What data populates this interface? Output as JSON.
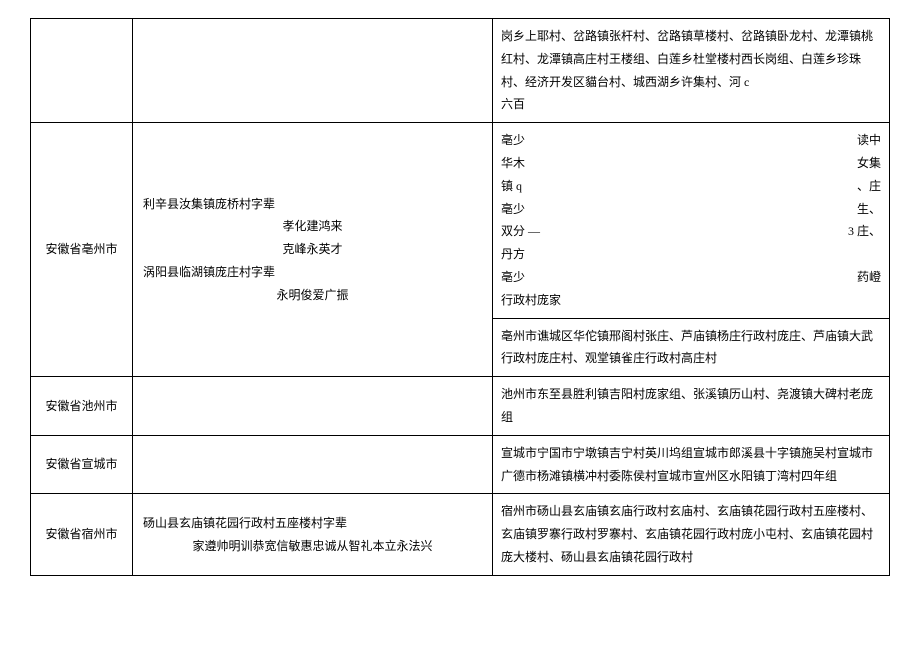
{
  "rows": [
    {
      "c1": "",
      "c2": "",
      "c3": "岗乡上耶村、岔路镇张杆村、岔路镇草楼村、岔路镇卧龙村、龙潭镇桃红村、龙潭镇高庄村王楼组、白莲乡杜堂楼村西长岗组、白莲乡珍珠村、经济开发区貓台村、城西湖乡许集村、河 c\n六百"
    },
    {
      "c1": "安徽省亳州市",
      "c2_block_a": {
        "line1": "利辛县汝集镇庞桥村字辈",
        "line2": "孝化建鸿来",
        "line3": "克峰永英才",
        "line4": "涡阳县临湖镇庞庄村字辈",
        "line5": "永明俊爱广振"
      },
      "c3_lines": [
        {
          "left": "亳少",
          "right": "读中"
        },
        {
          "left": "华木",
          "right": "女集"
        },
        {
          "left": "镇 q",
          "right": "、庄"
        },
        {
          "left": "亳少",
          "right": "生、"
        },
        {
          "left": "双分          —",
          "right": "3 庄、"
        },
        {
          "left": "丹方",
          "right": ""
        },
        {
          "left": "亳少",
          "right": "药嶝"
        },
        {
          "left": "行政村庞家",
          "right": ""
        }
      ],
      "c3_bottom": "亳州市谯城区华佗镇邢阁村张庄、芦庙镇杨庄行政村庞庄、芦庙镇大武行政村庞庄村、观堂镇雀庄行政村高庄村"
    },
    {
      "c1": "安徽省池州市",
      "c2": "",
      "c3": "池州市东至县胜利镇吉阳村庞家组、张溪镇历山村、尧渡镇大碑村老庞组"
    },
    {
      "c1": "安徽省宣城市",
      "c2": "",
      "c3": "宣城市宁国市宁墩镇吉宁村英川坞组宣城市郎溪县十字镇施吴村宣城市广德市杨滩镇横冲村委陈侯村宣城市宣州区水阳镇丁湾村四年组"
    },
    {
      "c1": "安徽省宿州市",
      "c2_l1": "砀山县玄庙镇花园行政村五座楼村字辈",
      "c2_l2": "家遵帅明训恭宽信敏惠忠诚从智礼本立永法兴",
      "c3": "宿州市砀山县玄庙镇玄庙行政村玄庙村、玄庙镇花园行政村五座楼村、玄庙镇罗寨行政村罗寨村、玄庙镇花园行政村庞小屯村、玄庙镇花园村庞大楼村、砀山县玄庙镇花园行政村"
    }
  ]
}
